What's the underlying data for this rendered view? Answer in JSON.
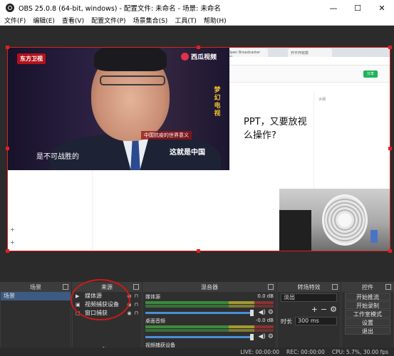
{
  "window": {
    "title": "OBS 25.0.8 (64-bit, windows) - 配置文件: 未命名 - 场景: 未命名"
  },
  "menu": [
    "文件(F)",
    "编辑(E)",
    "查看(V)",
    "配置文件(P)",
    "场景集合(S)",
    "工具(T)",
    "帮助(H)"
  ],
  "video": {
    "channel": "东方卫视",
    "brand": "西瓜视频",
    "vertical_text": "梦幻电视",
    "caption": "是不可战胜的",
    "lower_third": "中国抗疫的世界意义",
    "lower_title": "这就是中国"
  },
  "browser": {
    "tabs": [
      "Open Broadcaster So...",
      "开不开收款"
    ],
    "doc_text_lines": [
      "PPT，又要放视",
      "么操作?"
    ],
    "green_button": "分享",
    "side_title": "大纲"
  },
  "docks": {
    "scenes": {
      "title": "场景",
      "items": [
        "场景"
      ]
    },
    "sources": {
      "title": "来源",
      "items": [
        {
          "icon": "▶",
          "label": "媒体源"
        },
        {
          "icon": "▣",
          "label": "视频捕获设备"
        },
        {
          "icon": "▢",
          "label": "窗口捕获"
        }
      ]
    },
    "mixer": {
      "title": "混音器",
      "channels": [
        {
          "name": "媒体源",
          "db": "0.0 dB"
        },
        {
          "name": "桌面音频",
          "db": "-0.0 dB"
        },
        {
          "name": "视频捕获设备",
          "db": ""
        }
      ]
    },
    "transitions": {
      "title": "转场特效",
      "selected": "淡出",
      "duration_label": "时长",
      "duration_value": "300 ms"
    },
    "controls": {
      "title": "控件",
      "buttons": [
        "开始推流",
        "开始录制",
        "工作室模式",
        "设置",
        "退出"
      ]
    }
  },
  "status": {
    "live": "LIVE: 00:00:00",
    "rec": "REC: 00:00:00",
    "cpu": "CPU: 5.7%, 30.00 fps"
  }
}
